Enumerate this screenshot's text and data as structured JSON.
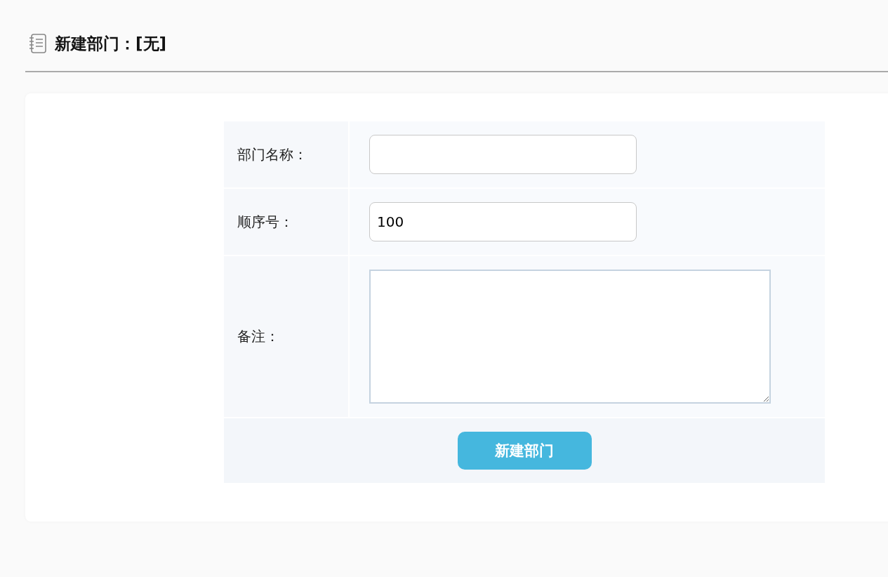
{
  "header": {
    "title": "新建部门：[无]"
  },
  "form": {
    "fields": [
      {
        "label": "部门名称：",
        "kind": "text"
      },
      {
        "label": "顺序号：",
        "kind": "text",
        "value": "100"
      },
      {
        "label": "备注：",
        "kind": "textarea"
      }
    ],
    "submit": "新建部门"
  }
}
